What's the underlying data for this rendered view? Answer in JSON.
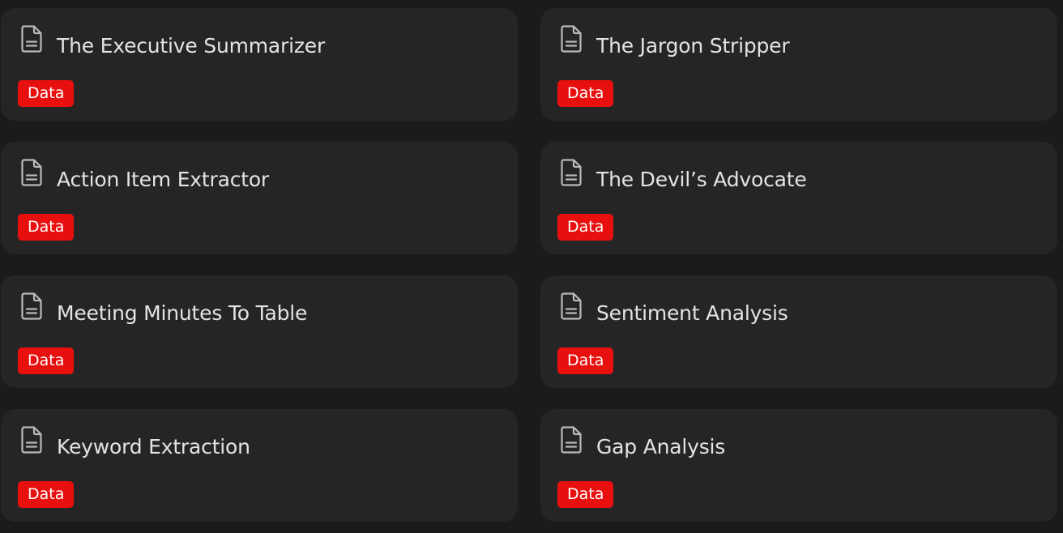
{
  "colors": {
    "background": "#1b1b1b",
    "card": "#252525",
    "title": "#e3e3e3",
    "badge": "#e8100f",
    "badge_text": "#ffffff",
    "icon": "#b9b9b9"
  },
  "cards": [
    {
      "title": "The Executive Summarizer",
      "tag": "Data",
      "icon": "document-icon"
    },
    {
      "title": "The Jargon Stripper",
      "tag": "Data",
      "icon": "document-icon"
    },
    {
      "title": "Action Item Extractor",
      "tag": "Data",
      "icon": "document-icon"
    },
    {
      "title": "The Devil’s Advocate",
      "tag": "Data",
      "icon": "document-icon"
    },
    {
      "title": "Meeting Minutes To Table",
      "tag": "Data",
      "icon": "document-icon"
    },
    {
      "title": "Sentiment Analysis",
      "tag": "Data",
      "icon": "document-icon"
    },
    {
      "title": "Keyword Extraction",
      "tag": "Data",
      "icon": "document-icon"
    },
    {
      "title": "Gap Analysis",
      "tag": "Data",
      "icon": "document-icon"
    }
  ]
}
